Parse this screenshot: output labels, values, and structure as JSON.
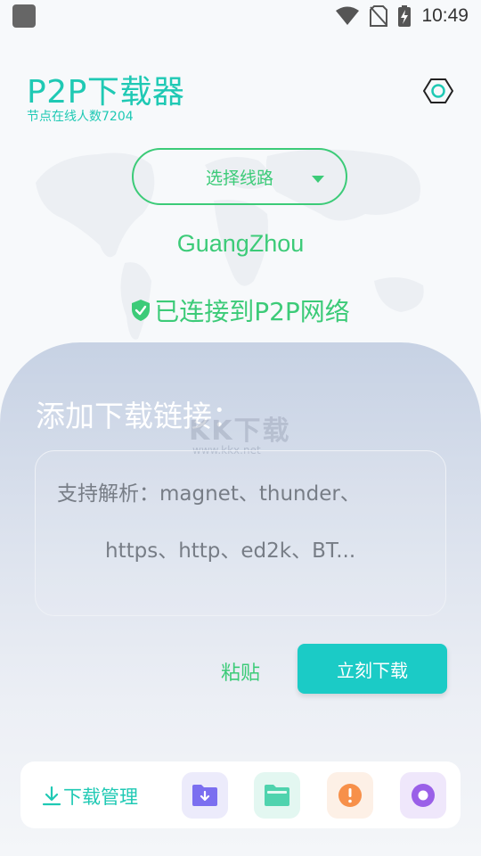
{
  "status_bar": {
    "time": "10:49"
  },
  "header": {
    "title": "P2P下载器",
    "node_count": "节点在线人数7204"
  },
  "route": {
    "label": "选择线路"
  },
  "location": {
    "city": "GuangZhou"
  },
  "connection": {
    "status": "已连接到P2P网络"
  },
  "download_panel": {
    "title": "添加下载链接：",
    "input_placeholder_line1": "支持解析：magnet、thunder、",
    "input_placeholder_line2": "https、http、ed2k、BT...",
    "paste_label": "粘贴",
    "download_label": "立刻下载"
  },
  "watermark": {
    "brand": "KK下载",
    "url": "www.kkx.net"
  },
  "bottom_bar": {
    "manage_label": "下载管理"
  },
  "colors": {
    "accent": "#1fc9b4",
    "green": "#3ccb78",
    "button": "#1bcbc6"
  }
}
